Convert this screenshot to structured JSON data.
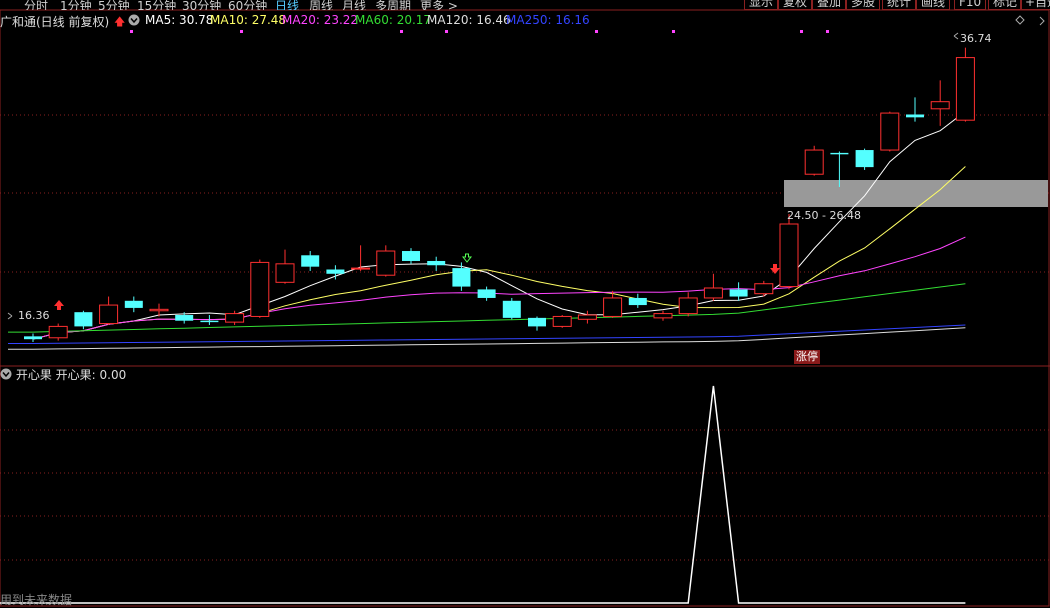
{
  "toolbar": {
    "periods": [
      "分时",
      "1分钟",
      "5分钟",
      "15分钟",
      "30分钟",
      "60分钟",
      "日线",
      "周线",
      "月线",
      "多周期",
      "更多 >"
    ],
    "active_period": "日线",
    "buttons": [
      "显示",
      "复权",
      "叠加",
      "多股",
      "统计",
      "画线",
      "F10",
      "标记",
      "+自选"
    ]
  },
  "header": {
    "stock_name": "广和通(日线 前复权)",
    "ma": [
      {
        "label": "MA5: 30.78",
        "color": "#ffffff"
      },
      {
        "label": "MA10: 27.48",
        "color": "#ffff66"
      },
      {
        "label": "MA20: 23.22",
        "color": "#ff44ff"
      },
      {
        "label": "MA60: 20.17",
        "color": "#33dd33"
      },
      {
        "label": "MA120: 16.46",
        "color": "#dddddd"
      },
      {
        "label": "MA250: 16.16",
        "color": "#3344ff"
      }
    ]
  },
  "price_labels": {
    "high": "36.74",
    "low": "16.36",
    "band": "24.50 - 26.48"
  },
  "badge": "涨停",
  "indicator": {
    "title": "开心果",
    "value_label": "开心果: 0.00"
  },
  "footer_note": "用到未来数据",
  "colors": {
    "up": "#ff3030",
    "down": "#54ffff",
    "grid": "#8a2020",
    "ma5": "#ffffff",
    "ma10": "#ffff66",
    "ma20": "#ff44ff",
    "ma60": "#33dd33",
    "ma120": "#dddddd",
    "ma250": "#3344ff"
  },
  "chart_data": {
    "type": "candlestick",
    "price_range": [
      15.5,
      38.0
    ],
    "candles": [
      {
        "o": 16.6,
        "c": 16.4,
        "h": 16.8,
        "l": 16.2
      },
      {
        "o": 16.5,
        "c": 17.3,
        "h": 17.5,
        "l": 16.3
      },
      {
        "o": 18.3,
        "c": 17.3,
        "h": 18.4,
        "l": 17.1
      },
      {
        "o": 17.5,
        "c": 18.8,
        "h": 19.4,
        "l": 17.4
      },
      {
        "o": 19.1,
        "c": 18.6,
        "h": 19.4,
        "l": 18.3
      },
      {
        "o": 18.4,
        "c": 18.5,
        "h": 18.9,
        "l": 18.0
      },
      {
        "o": 18.1,
        "c": 17.7,
        "h": 18.3,
        "l": 17.5
      },
      {
        "o": 17.7,
        "c": 17.6,
        "h": 18.1,
        "l": 17.4
      },
      {
        "o": 17.6,
        "c": 18.2,
        "h": 18.4,
        "l": 17.4
      },
      {
        "o": 18.0,
        "c": 21.8,
        "h": 22.0,
        "l": 17.9
      },
      {
        "o": 20.4,
        "c": 21.7,
        "h": 22.7,
        "l": 20.3
      },
      {
        "o": 22.3,
        "c": 21.5,
        "h": 22.6,
        "l": 21.2
      },
      {
        "o": 21.3,
        "c": 21.0,
        "h": 21.6,
        "l": 20.6
      },
      {
        "o": 21.4,
        "c": 21.4,
        "h": 23.0,
        "l": 21.2
      },
      {
        "o": 20.9,
        "c": 22.6,
        "h": 23.0,
        "l": 20.8
      },
      {
        "o": 22.6,
        "c": 21.9,
        "h": 22.8,
        "l": 21.7
      },
      {
        "o": 21.9,
        "c": 21.6,
        "h": 22.2,
        "l": 21.2
      },
      {
        "o": 21.4,
        "c": 20.1,
        "h": 21.8,
        "l": 19.8
      },
      {
        "o": 19.9,
        "c": 19.3,
        "h": 20.1,
        "l": 19.1
      },
      {
        "o": 19.1,
        "c": 17.9,
        "h": 19.3,
        "l": 17.8
      },
      {
        "o": 17.9,
        "c": 17.3,
        "h": 18.0,
        "l": 17.0
      },
      {
        "o": 17.3,
        "c": 18.0,
        "h": 18.1,
        "l": 17.2
      },
      {
        "o": 17.8,
        "c": 18.1,
        "h": 18.4,
        "l": 17.5
      },
      {
        "o": 18.0,
        "c": 19.3,
        "h": 19.8,
        "l": 17.9
      },
      {
        "o": 19.3,
        "c": 18.8,
        "h": 19.6,
        "l": 18.6
      },
      {
        "o": 17.9,
        "c": 18.2,
        "h": 18.4,
        "l": 17.7
      },
      {
        "o": 18.2,
        "c": 19.3,
        "h": 19.7,
        "l": 18.0
      },
      {
        "o": 19.3,
        "c": 20.0,
        "h": 21.0,
        "l": 19.1
      },
      {
        "o": 19.9,
        "c": 19.4,
        "h": 20.4,
        "l": 19.1
      },
      {
        "o": 19.6,
        "c": 20.3,
        "h": 20.5,
        "l": 19.4
      },
      {
        "o": 20.1,
        "c": 24.5,
        "h": 25.2,
        "l": 19.9
      },
      {
        "o": 28.0,
        "c": 29.7,
        "h": 30.0,
        "l": 27.9
      },
      {
        "o": 29.5,
        "c": 29.4,
        "h": 29.6,
        "l": 27.1
      },
      {
        "o": 29.7,
        "c": 28.5,
        "h": 29.8,
        "l": 28.3
      },
      {
        "o": 29.7,
        "c": 32.3,
        "h": 32.4,
        "l": 29.6
      },
      {
        "o": 32.2,
        "c": 32.0,
        "h": 33.4,
        "l": 31.7
      },
      {
        "o": 32.6,
        "c": 33.1,
        "h": 34.6,
        "l": 31.4
      },
      {
        "o": 31.8,
        "c": 36.2,
        "h": 36.9,
        "l": 31.7
      }
    ],
    "indicator_values": [
      0,
      0,
      0,
      0,
      0,
      0,
      0,
      0,
      0,
      0,
      0,
      0,
      0,
      0,
      0,
      0,
      0,
      0,
      0,
      0,
      0,
      0,
      0,
      0,
      0,
      0,
      0,
      1,
      0,
      0,
      0,
      0,
      0,
      0,
      0,
      0,
      0,
      0
    ]
  }
}
